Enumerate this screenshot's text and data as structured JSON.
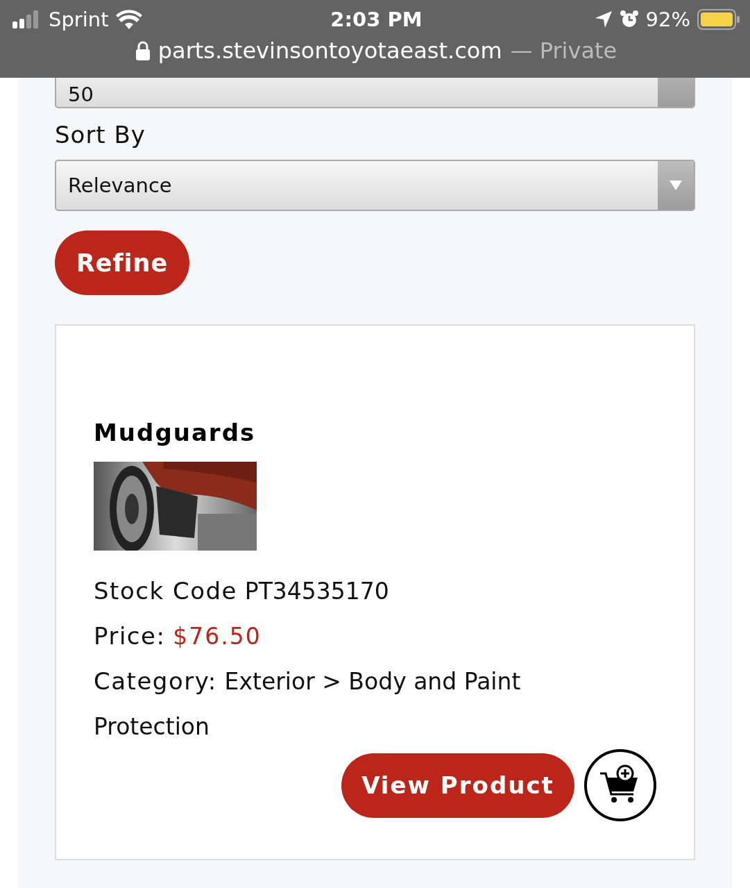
{
  "status_bar": {
    "carrier": "Sprint",
    "time": "2:03 PM",
    "battery": "92%"
  },
  "address_bar": {
    "url": "parts.stevinsontoyotaeast.com",
    "mode": "— Private"
  },
  "per_page": {
    "value": "50"
  },
  "sort": {
    "label": "Sort By",
    "value": "Relevance"
  },
  "refine_button": "Refine",
  "product": {
    "title": "Mudguards",
    "fields": [
      {
        "label": "Stock Code",
        "value": "PT34535170",
        "kind": "plain"
      },
      {
        "label": "Price:",
        "value": "$76.50",
        "kind": "price"
      },
      {
        "label": "Category:",
        "value": "Exterior > Body and Paint Protection",
        "kind": "plain"
      }
    ],
    "view_button": "View Product"
  }
}
